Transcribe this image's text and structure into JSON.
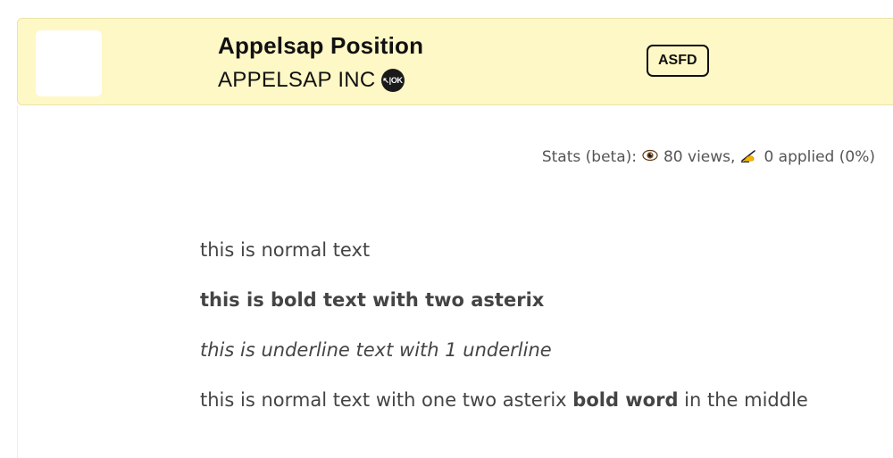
{
  "header": {
    "job_title": "Appelsap Position",
    "company_name": "APPELSAP INC",
    "verified_badge_text": "↖|OK",
    "tag_label": "ASFD",
    "background_color": "#fef8c6"
  },
  "stats": {
    "prefix": "Stats (beta):",
    "views_icon": "eye-icon",
    "views_text": "80 views,",
    "applied_icon": "writing-hand-icon",
    "applied_text": "0 applied (0%)"
  },
  "description": {
    "line1": "this is normal text",
    "line2": "this is bold text with two asterix",
    "line3": "this is underline text with 1 underline",
    "line4_before": "this is normal text with one two asterix ",
    "line4_bold": "bold word",
    "line4_after": " in the middle"
  }
}
